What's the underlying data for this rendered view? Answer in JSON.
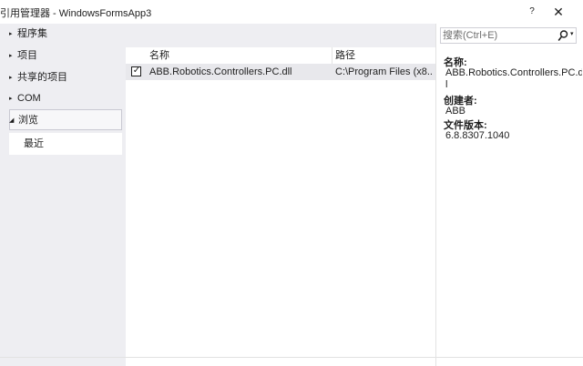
{
  "window": {
    "title": "引用管理器 - WindowsFormsApp3",
    "help_glyph": "?",
    "close_glyph": "✕"
  },
  "nav": {
    "items": [
      {
        "label": "程序集",
        "arrow": "▸"
      },
      {
        "label": "项目",
        "arrow": "▸"
      },
      {
        "label": "共享的项目",
        "arrow": "▸"
      },
      {
        "label": "COM",
        "arrow": "▸"
      },
      {
        "label": "浏览",
        "arrow": "◢"
      }
    ],
    "child": {
      "label": "最近"
    }
  },
  "grid": {
    "columns": [
      "名称",
      "路径"
    ],
    "rows": [
      {
        "checked": true,
        "check_glyph": "✓",
        "name": "ABB.Robotics.Controllers.PC.dll",
        "path": "C:\\Program Files (x8..."
      }
    ]
  },
  "search": {
    "placeholder": "搜索(Ctrl+E)",
    "dropdown_glyph": "▾"
  },
  "details": {
    "name_label": "名称:",
    "name_value": "ABB.Robotics.Controllers.PC.d",
    "name_value_cont": "l",
    "creator_label": "创建者:",
    "creator_value": "ABB",
    "version_label": "文件版本:",
    "version_value": "6.8.8307.1040"
  },
  "colors": {
    "panel_bg": "#eeeef2",
    "row_selected_bg": "#e8e8ec",
    "border": "#e2e2e2"
  }
}
